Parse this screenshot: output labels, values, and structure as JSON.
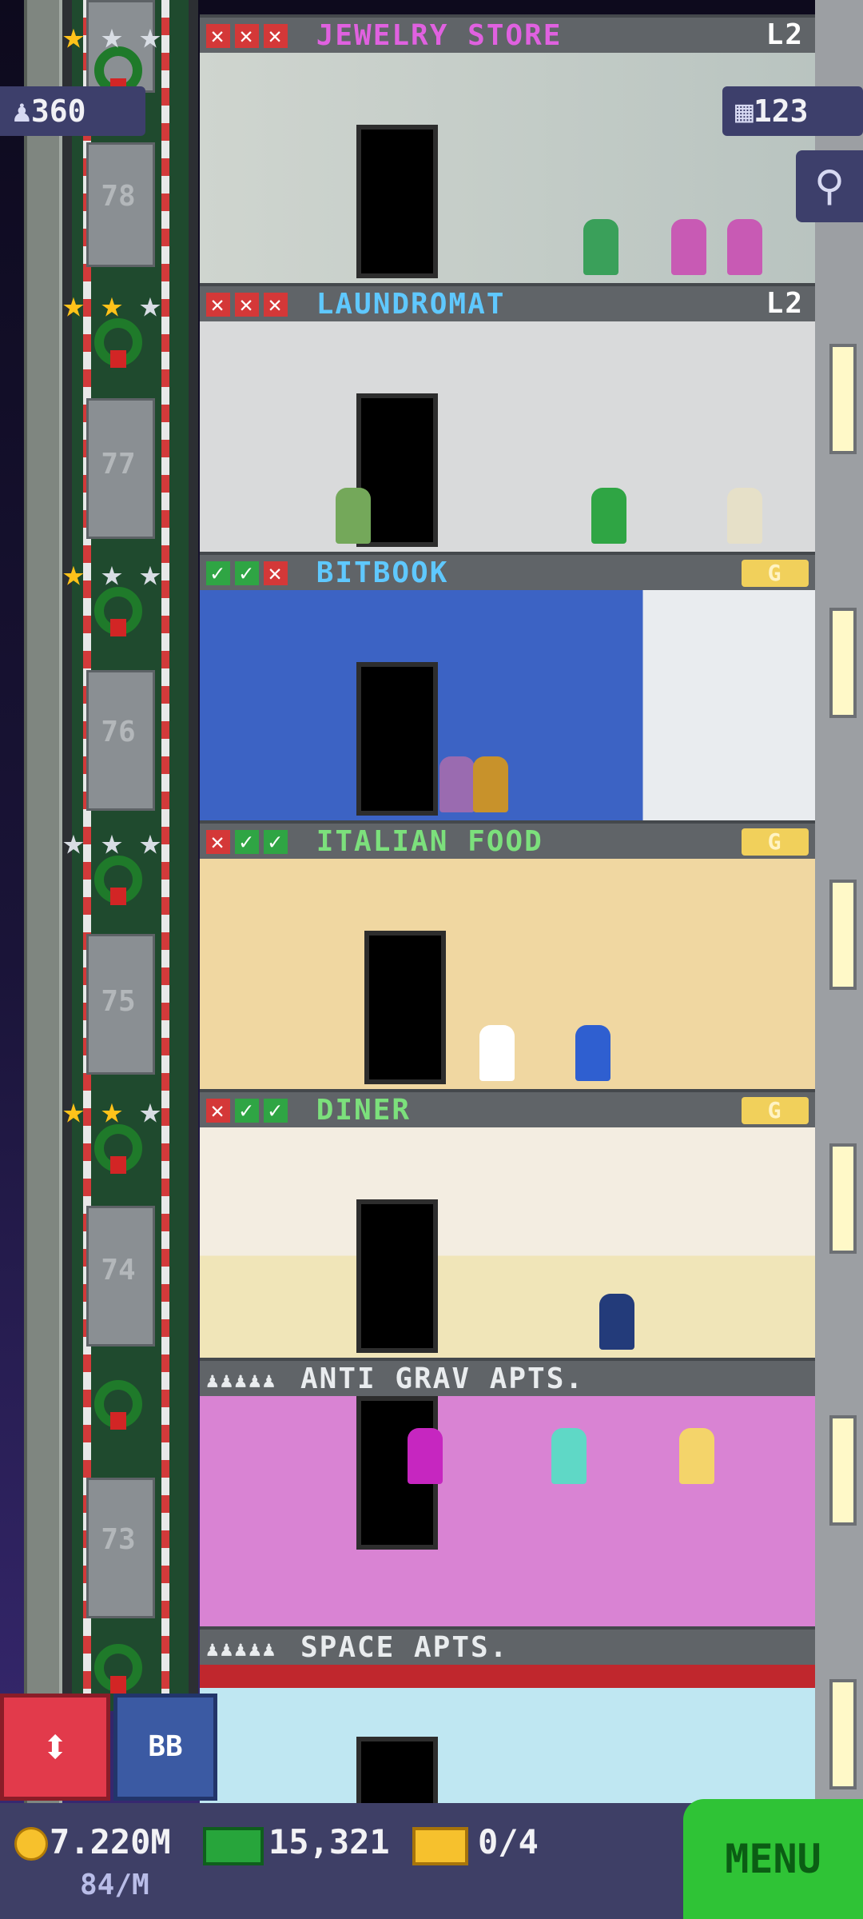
{
  "hud": {
    "population": "360",
    "floors_count": "123",
    "coins": "7.220M",
    "coin_rate": "84/M",
    "bux": "15,321",
    "tickets": "0/4",
    "menu_label": "MENU",
    "bb_label": "BB"
  },
  "floors": [
    {
      "number": "",
      "name": "JEWELRY STORE",
      "name_color": "#e061e0",
      "level": "L2",
      "marks": [
        "x",
        "x",
        "x"
      ],
      "stars": [
        "gold",
        "silver",
        "silver"
      ],
      "room_color": "#cfd3cf"
    },
    {
      "number": "78",
      "name": "LAUNDROMAT",
      "name_color": "#5fc8ff",
      "level": "L2",
      "marks": [
        "x",
        "x",
        "x"
      ],
      "stars": [
        "gold",
        "gold",
        "silver"
      ],
      "room_color": "#d9dadb"
    },
    {
      "number": "77",
      "name": "BITBOOK",
      "name_color": "#5fc8ff",
      "level": "G",
      "marks": [
        "c",
        "c",
        "x"
      ],
      "stars": [
        "gold",
        "silver",
        "silver"
      ],
      "room_color": "#3c63c4"
    },
    {
      "number": "76",
      "name": "ITALIAN FOOD",
      "name_color": "#7ce07c",
      "level": "G",
      "marks": [
        "x",
        "c",
        "c"
      ],
      "stars": [
        "silver",
        "silver",
        "silver"
      ],
      "room_color": "#f0d7a1"
    },
    {
      "number": "75",
      "name": "DINER",
      "name_color": "#7ce07c",
      "level": "G",
      "marks": [
        "x",
        "c",
        "c"
      ],
      "stars": [
        "gold",
        "gold",
        "silver"
      ],
      "room_color": "#f3ede1"
    },
    {
      "number": "74",
      "name": "ANTI GRAV APTS.",
      "name_color": "#e9ecee",
      "level": "",
      "marks": [],
      "stars": [],
      "room_color": "#d983d3"
    },
    {
      "number": "73",
      "name": "SPACE APTS.",
      "name_color": "#e9ecee",
      "level": "",
      "marks": [],
      "stars": [],
      "room_color": "#bfe7f2"
    }
  ],
  "icons": {
    "population": "person-icon",
    "floors": "building-icon",
    "search": "magnifier-icon",
    "elevator": "up-down-arrows-icon",
    "coin": "coin-icon",
    "bux": "bux-icon",
    "ticket": "ticket-icon"
  }
}
